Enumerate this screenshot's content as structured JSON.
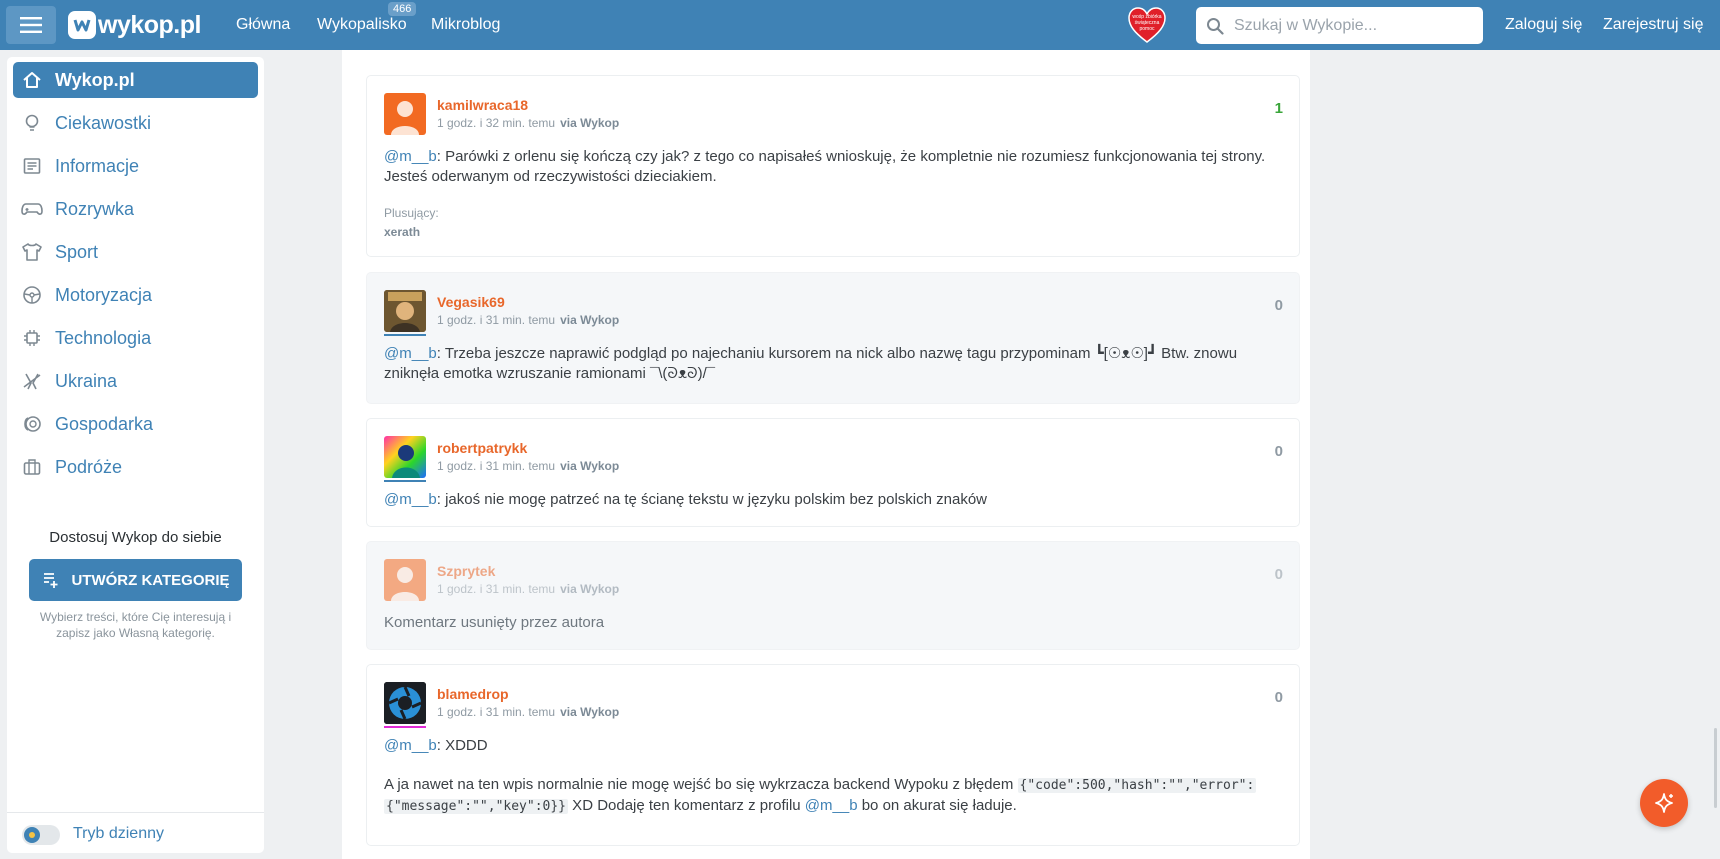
{
  "header": {
    "logo_text": "wykop.pl",
    "nav": [
      {
        "label": "Główna"
      },
      {
        "label": "Wykopalisko",
        "badge": "466"
      },
      {
        "label": "Mikroblog"
      }
    ],
    "heart_text": "wośp zbiórka świąteczna pomoc",
    "search_placeholder": "Szukaj w Wykopie...",
    "login": "Zaloguj się",
    "register": "Zarejestruj się"
  },
  "sidebar": {
    "items": [
      {
        "label": "Wykop.pl",
        "icon": "home-icon"
      },
      {
        "label": "Ciekawostki",
        "icon": "lightbulb-icon"
      },
      {
        "label": "Informacje",
        "icon": "newspaper-icon"
      },
      {
        "label": "Rozrywka",
        "icon": "gamepad-icon"
      },
      {
        "label": "Sport",
        "icon": "shirt-icon"
      },
      {
        "label": "Motoryzacja",
        "icon": "steering-wheel-icon"
      },
      {
        "label": "Technologia",
        "icon": "chip-icon"
      },
      {
        "label": "Ukraina",
        "icon": "ukraine-icon"
      },
      {
        "label": "Gospodarka",
        "icon": "coins-icon"
      },
      {
        "label": "Podróże",
        "icon": "luggage-icon"
      }
    ],
    "customize_title": "Dostosuj Wykop do siebie",
    "create_button": "UTWÓRZ KATEGORIĘ",
    "customize_desc": "Wybierz treści, które Cię interesują i zapisz jako Własną kategorię.",
    "theme_label": "Tryb dzienny"
  },
  "comments": [
    {
      "author": "kamilwraca18",
      "time": "1 godz. i 32 min. temu",
      "via": "via Wykop",
      "votes": "1",
      "mention": "@m__b",
      "text": ": Parówki z orlenu się kończą czy jak? z tego co napisałeś wnioskuję, że kompletnie nie rozumiesz funkcjonowania tej strony. Jesteś oderwanym od rzeczywistości dzieciakiem.",
      "plus_label": "Plusujący:",
      "plus_user": "xerath"
    },
    {
      "author": "Vegasik69",
      "time": "1 godz. i 31 min. temu",
      "via": "via Wykop",
      "votes": "0",
      "mention": "@m__b",
      "text": ": Trzeba jeszcze naprawić podgląd po najechaniu kursorem na nick albo nazwę tagu przypominam ┗[☉ᴥ☉]┛ Btw. znowu zniknęła emotka wzruszanie ramionami ¯\\(ᘐᴥᘐ)/¯"
    },
    {
      "author": "robertpatrykk",
      "time": "1 godz. i 31 min. temu",
      "via": "via Wykop",
      "votes": "0",
      "mention": "@m__b",
      "text": ": jakoś nie mogę patrzeć na tę ścianę tekstu w języku polskim bez polskich znaków"
    },
    {
      "author": "Szprytek",
      "time": "1 godz. i 31 min. temu",
      "via": "via Wykop",
      "votes": "0",
      "text": "Komentarz usunięty przez autora"
    },
    {
      "author": "blamedrop",
      "time": "1 godz. i 31 min. temu",
      "via": "via Wykop",
      "votes": "0",
      "mention": "@m__b",
      "text": ": XDDD",
      "text2_before": "A ja nawet na ten wpis normalnie nie mogę wejść bo się wykrzacza backend Wypoku z błędem ",
      "code1": "{\"code\":500,\"hash\":\"\",\"error\":",
      "code2": "{\"message\":\"\",\"key\":0}}",
      "text2_after": " XD Dodaję ten komentarz z profilu ",
      "mention2": "@m__b",
      "text2_end": " bo on akurat się ładuje."
    }
  ],
  "colors": {
    "brand": "#3f82b5",
    "author": "#e8672b",
    "fab": "#f25c2a"
  }
}
